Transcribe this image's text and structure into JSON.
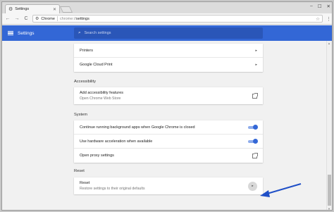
{
  "browser": {
    "tab_title": "Settings",
    "tab_close": "✕",
    "url_label": "Chrome",
    "url_scheme": "chrome://",
    "url_path": "settings",
    "win_min": "–",
    "win_max": "☐",
    "win_close": "✕",
    "back": "←",
    "forward": "→",
    "reload": "C",
    "star": "☆",
    "menu": "⋮"
  },
  "header": {
    "title": "Settings",
    "search_placeholder": "Search settings"
  },
  "printing": {
    "items": [
      {
        "label": "Printers"
      },
      {
        "label": "Google Cloud Print"
      }
    ]
  },
  "accessibility": {
    "section_title": "Accessibility",
    "add_features_label": "Add accessibility features",
    "add_features_sub": "Open Chrome Web Store"
  },
  "system": {
    "section_title": "System",
    "background_apps_label": "Continue running background apps when Google Chrome is closed",
    "background_apps_on": true,
    "hw_accel_label": "Use hardware acceleration when available",
    "hw_accel_on": true,
    "proxy_label": "Open proxy settings"
  },
  "reset": {
    "section_title": "Reset",
    "reset_label": "Reset",
    "reset_sub": "Restore settings to their original defaults"
  },
  "colors": {
    "accent": "#3367d6",
    "annotation_arrow": "#1f4fc7"
  },
  "icons": {
    "settings_tab": "gear-icon",
    "menu": "hamburger-icon",
    "search": "search-icon",
    "external": "external-link-icon",
    "arrow": "chevron-right-icon"
  }
}
